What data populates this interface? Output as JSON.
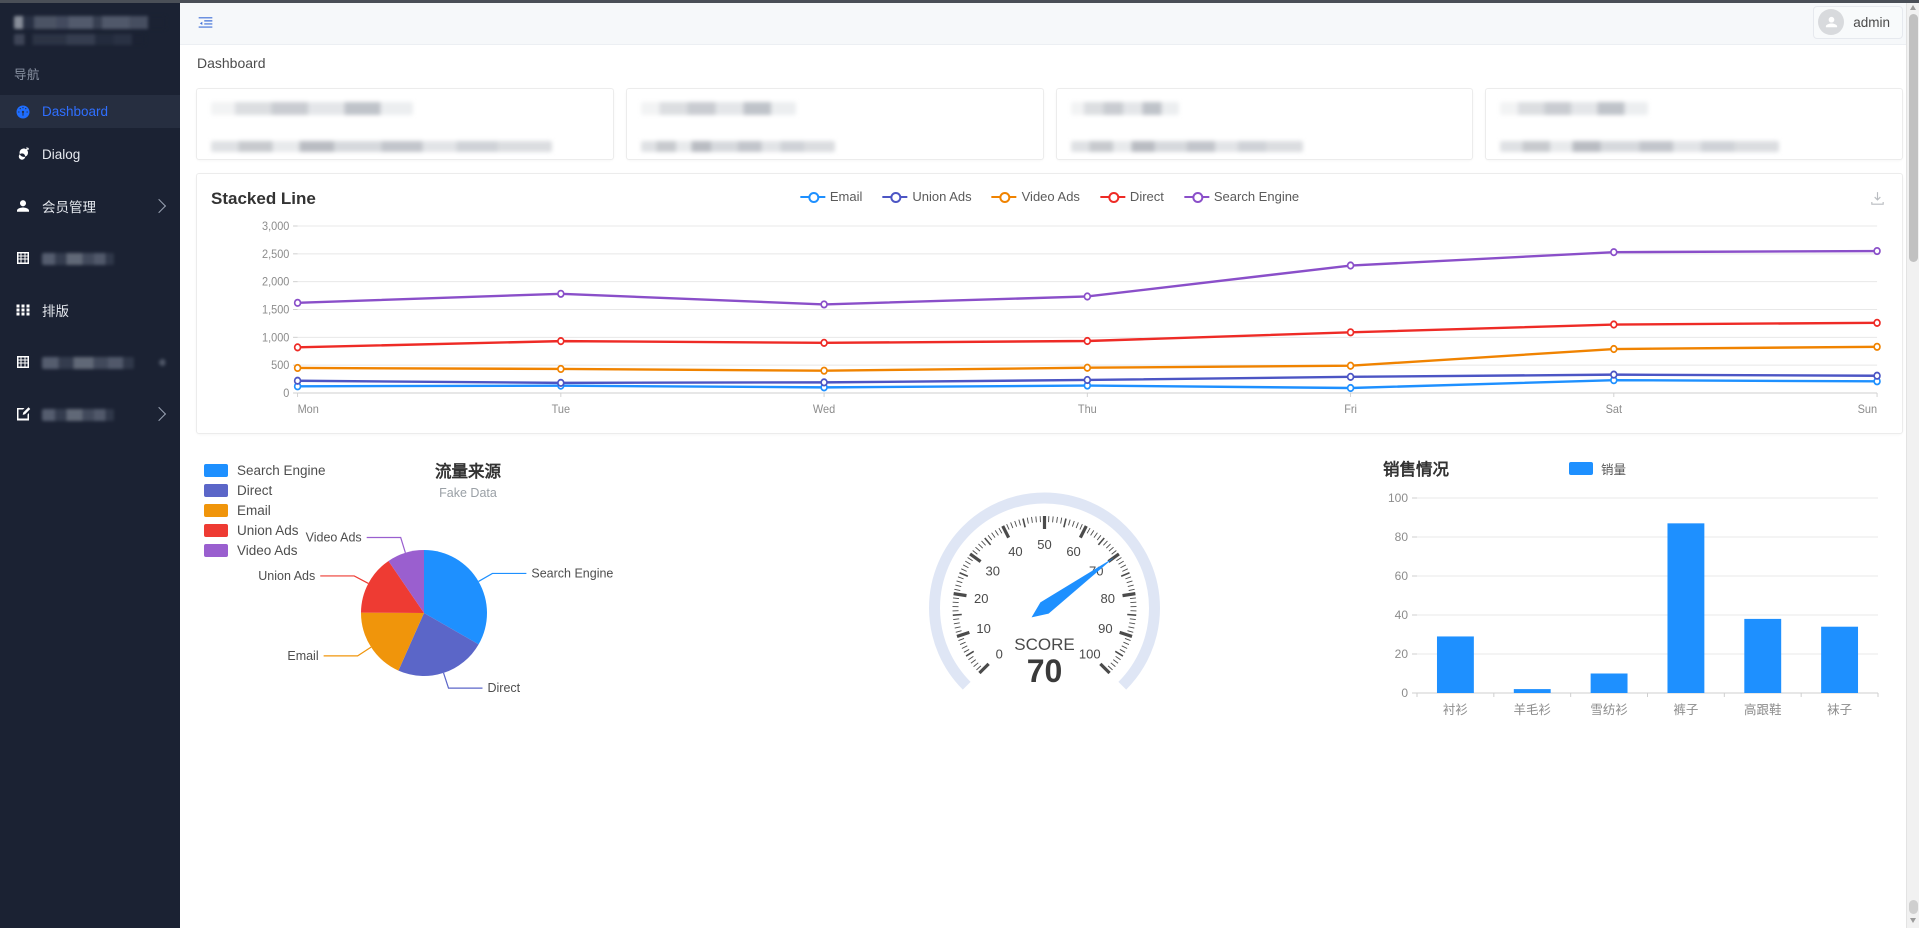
{
  "window": {
    "title": "Dashboard",
    "accent": "#1e6dff"
  },
  "sidebar": {
    "brand_redacted": true,
    "nav_title": "导航",
    "items": [
      {
        "label": "Dashboard",
        "icon": "dashboard-gauge-icon",
        "active": true,
        "has_chevron": false,
        "redacted": false
      },
      {
        "label": "Dialog",
        "icon": "bomb-icon",
        "active": false,
        "has_chevron": false,
        "redacted": false
      },
      {
        "label": "会员管理",
        "icon": "user-icon",
        "active": false,
        "has_chevron": true,
        "redacted": false
      },
      {
        "label": "",
        "icon": "table-icon",
        "active": false,
        "has_chevron": false,
        "redacted": true
      },
      {
        "label": "排版",
        "icon": "grid-dots-icon",
        "active": false,
        "has_chevron": false,
        "redacted": false
      },
      {
        "label": "",
        "icon": "table-icon",
        "active": false,
        "has_chevron": false,
        "redacted": true
      },
      {
        "label": "",
        "icon": "edit-square-icon",
        "active": false,
        "has_chevron": true,
        "redacted": true
      }
    ]
  },
  "topbar": {
    "collapse_icon": "menu-fold-icon",
    "user": {
      "name": "admin",
      "avatar_icon": "user-avatar-icon"
    }
  },
  "breadcrumb": {
    "text": "Dashboard"
  },
  "stat_cards": [
    {
      "redacted": true
    },
    {
      "redacted": true
    },
    {
      "redacted": true
    },
    {
      "redacted": true
    }
  ],
  "line_panel": {
    "title": "Stacked Line",
    "download_icon": "download-icon"
  },
  "pie_panel": {
    "title": "流量来源",
    "subtitle": "Fake Data"
  },
  "gauge_panel": {
    "label": "SCORE",
    "value": "70"
  },
  "bar_panel": {
    "title": "销售情况",
    "legend": "销量"
  },
  "chart_data": [
    {
      "type": "line",
      "title": "Stacked Line",
      "categories": [
        "Mon",
        "Tue",
        "Wed",
        "Thu",
        "Fri",
        "Sat",
        "Sun"
      ],
      "xlabel": "",
      "ylabel": "",
      "ylim": [
        0,
        3000
      ],
      "yticks": [
        "0",
        "500",
        "1,000",
        "1,500",
        "2,000",
        "2,500",
        "3,000"
      ],
      "grid": true,
      "legend_position": "top-center",
      "series": [
        {
          "name": "Email",
          "color": "#1e90ff",
          "values": [
            120,
            132,
            101,
            134,
            90,
            230,
            210
          ]
        },
        {
          "name": "Union Ads",
          "color": "#4c55c4",
          "values": [
            220,
            182,
            191,
            234,
            290,
            330,
            310
          ]
        },
        {
          "name": "Video Ads",
          "color": "#f08300",
          "values": [
            450,
            432,
            401,
            454,
            490,
            790,
            830
          ]
        },
        {
          "name": "Direct",
          "color": "#ee2b26",
          "values": [
            820,
            932,
            901,
            934,
            1090,
            1230,
            1260
          ]
        },
        {
          "name": "Search Engine",
          "color": "#8a4fc9",
          "values": [
            1620,
            1782,
            1591,
            1734,
            2290,
            2530,
            2550
          ]
        }
      ]
    },
    {
      "type": "pie",
      "title": "流量来源",
      "subtitle": "Fake Data",
      "legend_position": "left",
      "labels": [
        "Search Engine",
        "Direct",
        "Email",
        "Union Ads",
        "Video Ads"
      ],
      "values": [
        1048,
        735,
        580,
        484,
        300
      ],
      "colors": [
        "#1e90ff",
        "#5b66c8",
        "#f0950b",
        "#ee3b33",
        "#9a5fcf"
      ]
    },
    {
      "type": "gauge",
      "title": "",
      "label": "SCORE",
      "value": 70,
      "min": 0,
      "max": 100,
      "ticks": [
        "0",
        "10",
        "20",
        "30",
        "40",
        "50",
        "60",
        "70",
        "80",
        "90",
        "100"
      ],
      "needle_color": "#1e90ff"
    },
    {
      "type": "bar",
      "title": "销售情况",
      "categories": [
        "衬衫",
        "羊毛衫",
        "雪纺衫",
        "裤子",
        "高跟鞋",
        "袜子"
      ],
      "values": [
        29,
        2,
        10,
        87,
        38,
        34
      ],
      "series": [
        {
          "name": "销量",
          "values": [
            29,
            2,
            10,
            87,
            38,
            34
          ]
        }
      ],
      "xlabel": "",
      "ylabel": "",
      "ylim": [
        0,
        100
      ],
      "yticks": [
        "0",
        "20",
        "40",
        "60",
        "80",
        "100"
      ],
      "grid": true,
      "color": "#1e90ff",
      "legend_position": "top-center"
    }
  ]
}
